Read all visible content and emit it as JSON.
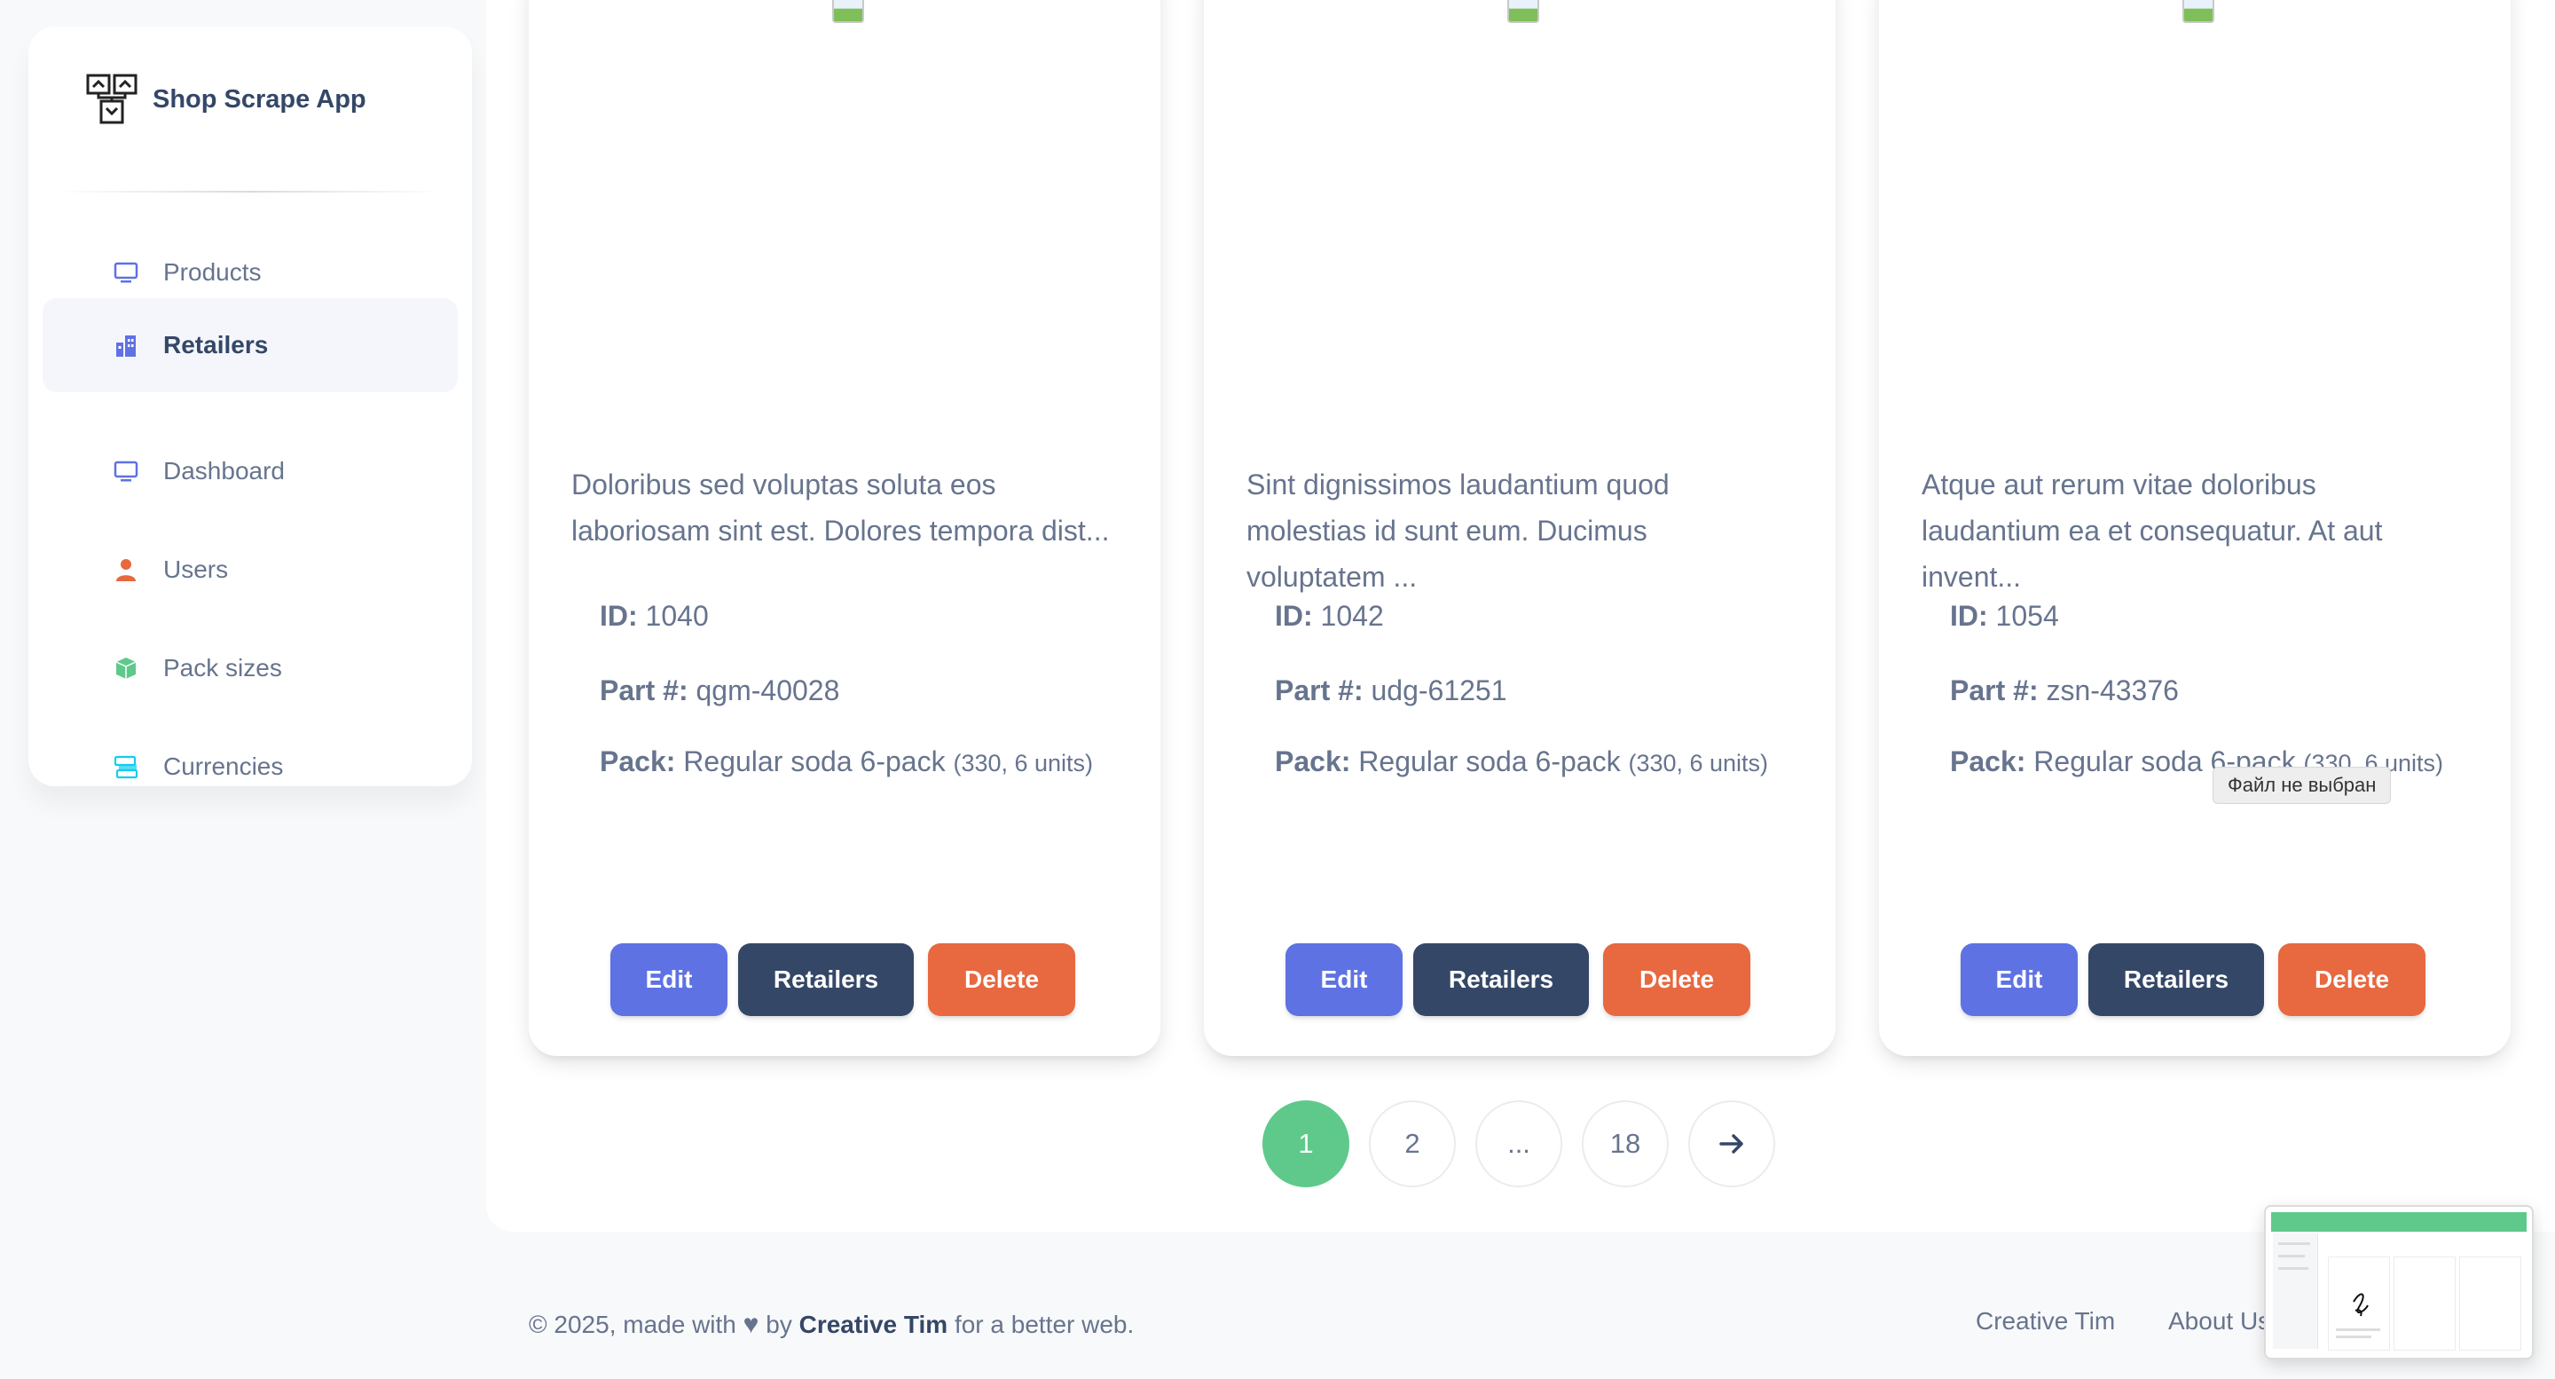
{
  "sidebar": {
    "brand": "Shop Scrape App",
    "items": [
      {
        "label": "Products",
        "icon": "monitor-icon",
        "color": "#5e72e4"
      },
      {
        "label": "Retailers",
        "icon": "building-icon",
        "color": "#5e72e4",
        "active": true
      },
      {
        "label": "Dashboard",
        "icon": "monitor-icon",
        "color": "#5e72e4"
      },
      {
        "label": "Users",
        "icon": "user-icon",
        "color": "#e8683f"
      },
      {
        "label": "Pack sizes",
        "icon": "box-icon",
        "color": "#5ec98b"
      },
      {
        "label": "Currencies",
        "icon": "money-icon",
        "color": "#11cdef"
      }
    ]
  },
  "cards": [
    {
      "description": "Doloribus sed voluptas soluta eos laboriosam sint est. Dolores tempora dist...",
      "id_label": "ID:",
      "id": "1040",
      "part_label": "Part #:",
      "part": "qgm-40028",
      "pack_label": "Pack:",
      "pack": "Regular soda 6-pack",
      "pack_detail": "(330, 6 units)"
    },
    {
      "description": "Sint dignissimos laudantium quod molestias id sunt eum. Ducimus voluptatem ...",
      "id_label": "ID:",
      "id": "1042",
      "part_label": "Part #:",
      "part": "udg-61251",
      "pack_label": "Pack:",
      "pack": "Regular soda 6-pack",
      "pack_detail": "(330, 6 units)"
    },
    {
      "description": "Atque aut rerum vitae doloribus laudantium ea et consequatur. At aut invent...",
      "id_label": "ID:",
      "id": "1054",
      "part_label": "Part #:",
      "part": "zsn-43376",
      "pack_label": "Pack:",
      "pack": "Regular soda 6-pack",
      "pack_detail": "(330, 6 units)"
    }
  ],
  "buttons": {
    "edit": "Edit",
    "retailers": "Retailers",
    "delete": "Delete"
  },
  "colors": {
    "edit": "#5e72e4",
    "retailers": "#344767",
    "delete": "#e8683f",
    "active_page": "#5ec98b"
  },
  "pagination": {
    "pages": [
      "1",
      "2",
      "...",
      "18"
    ],
    "current": "1",
    "next_icon": "arrow-right-icon"
  },
  "tooltip": "Файл не выбран",
  "footer": {
    "copyright": "© 2025, made with",
    "by": "by",
    "author": "Creative Tim",
    "tail": "for a better web.",
    "links": [
      "Creative Tim",
      "About Us"
    ]
  }
}
